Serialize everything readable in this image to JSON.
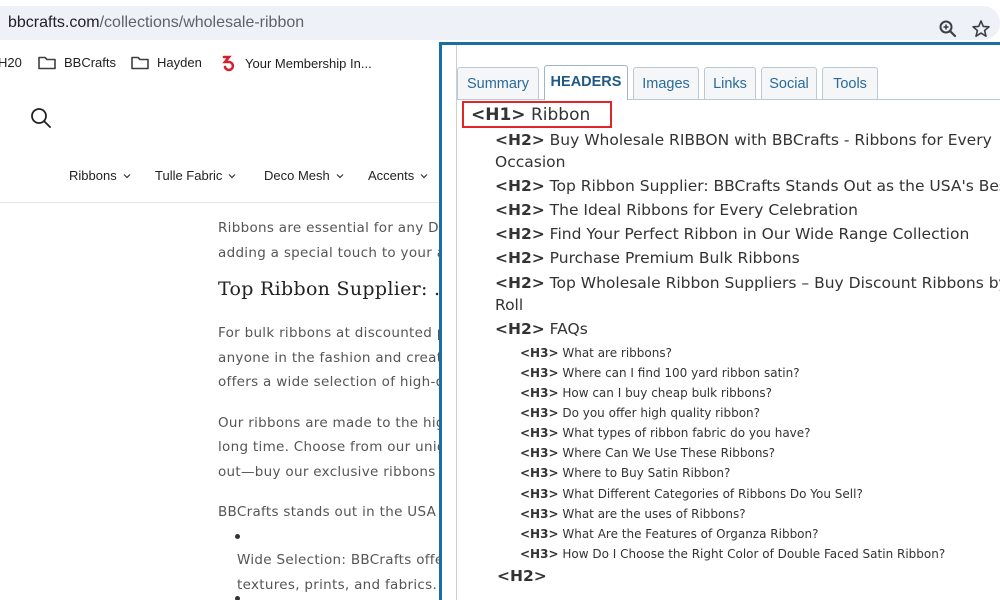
{
  "browser": {
    "url_domain": "bbcrafts.com",
    "url_path": "/collections/wholesale-ribbon"
  },
  "bookmarks": [
    {
      "label": "H20"
    },
    {
      "label": "BBCrafts"
    },
    {
      "label": "Hayden"
    },
    {
      "label": "Your Membership In..."
    }
  ],
  "site": {
    "nav": [
      "Ribbons",
      "Tulle Fabric",
      "Deco Mesh",
      "Accents"
    ],
    "lines": [
      "Ribbons are essential for any DIY",
      "adding a special touch to your ar",
      "Top Ribbon Supplier: .",
      "For bulk ribbons at discounted p",
      "anyone in the fashion and creatio",
      "offers a wide selection of high-qu",
      "Our ribbons are made to the hig",
      "long time. Choose from our uniq",
      "out—buy our exclusive ribbons to",
      "BBCrafts stands out in the USA f",
      "Wide Selection: BBCrafts offe",
      "textures, prints, and fabrics."
    ]
  },
  "panel": {
    "tabs": [
      "Summary",
      "HEADERS",
      "Images",
      "Links",
      "Social",
      "Tools"
    ],
    "active_tab": "HEADERS",
    "highlight_color": "#e0252b",
    "headers": [
      {
        "tag": "<H1>",
        "text": "Ribbon"
      },
      {
        "tag": "<H2>",
        "text": "Buy Wholesale RIBBON with BBCrafts - Ribbons for Every",
        "cont": "Occasion"
      },
      {
        "tag": "<H2>",
        "text": "Top Ribbon Supplier: BBCrafts Stands Out as the USA's Best"
      },
      {
        "tag": "<H2>",
        "text": "The Ideal Ribbons for Every Celebration"
      },
      {
        "tag": "<H2>",
        "text": "Find Your Perfect Ribbon in Our Wide Range Collection"
      },
      {
        "tag": "<H2>",
        "text": "Purchase Premium Bulk Ribbons"
      },
      {
        "tag": "<H2>",
        "text": "Top Wholesale Ribbon Suppliers – Buy Discount Ribbons by the",
        "cont": "Roll"
      },
      {
        "tag": "<H2>",
        "text": "FAQs"
      },
      {
        "tag": "<H3>",
        "text": "What are ribbons?"
      },
      {
        "tag": "<H3>",
        "text": "Where can I find 100 yard ribbon satin?"
      },
      {
        "tag": "<H3>",
        "text": "How can I buy cheap bulk ribbons?"
      },
      {
        "tag": "<H3>",
        "text": "Do you offer high quality ribbon?"
      },
      {
        "tag": "<H3>",
        "text": "What types of ribbon fabric do you have?"
      },
      {
        "tag": "<H3>",
        "text": "Where Can We Use These Ribbons?"
      },
      {
        "tag": "<H3>",
        "text": "Where to Buy Satin Ribbon?"
      },
      {
        "tag": "<H3>",
        "text": "What Different Categories of Ribbons Do You Sell?"
      },
      {
        "tag": "<H3>",
        "text": "What are the uses of Ribbons?"
      },
      {
        "tag": "<H3>",
        "text": "What Are the Features of Organza Ribbon?"
      },
      {
        "tag": "<H3>",
        "text": "How Do I Choose the Right Color of Double Faced Satin Ribbon?"
      },
      {
        "tag": "<H2>",
        "text": ""
      }
    ]
  }
}
